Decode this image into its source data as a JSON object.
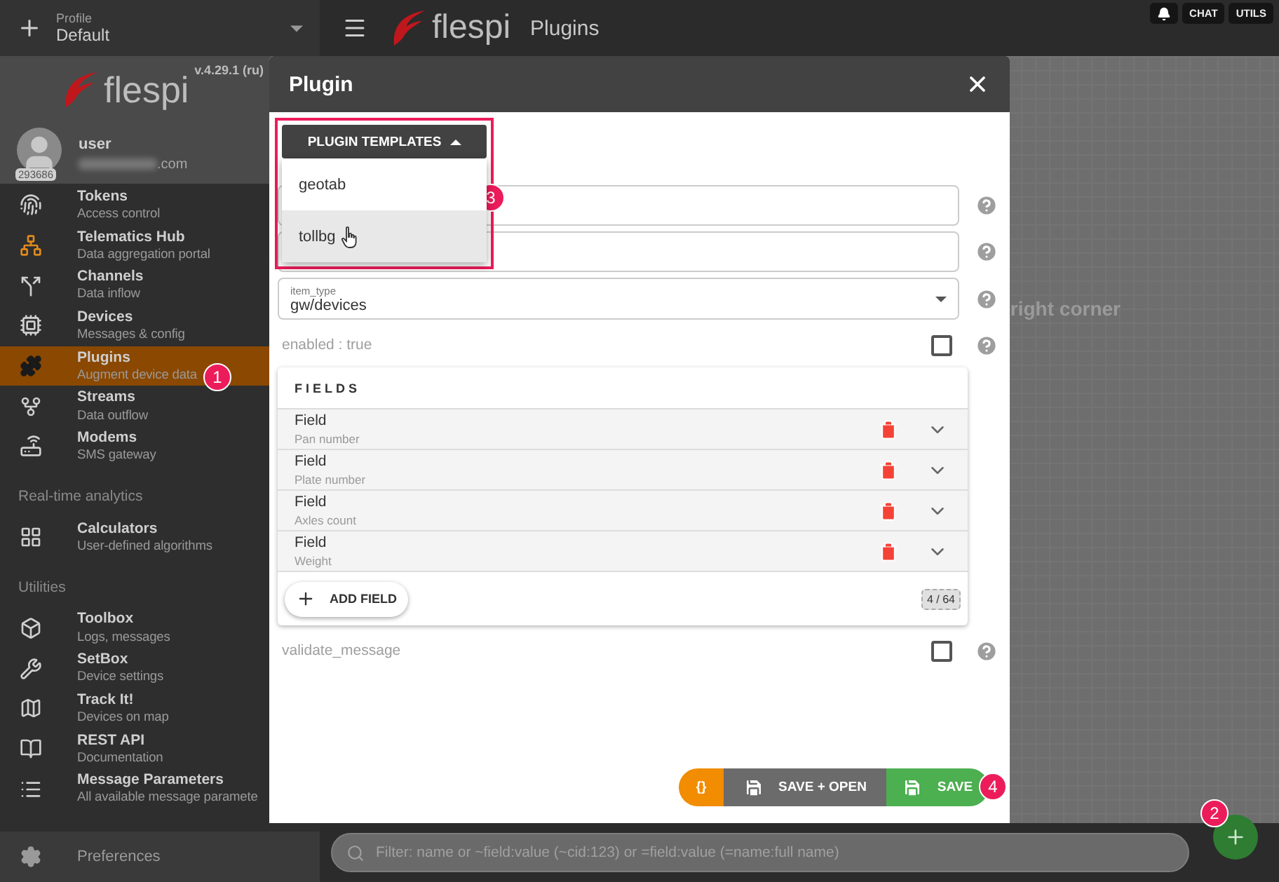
{
  "profile": {
    "label": "Profile",
    "value": "Default"
  },
  "sidebar_logo": "flespi",
  "version": "v.4.29.1 (ru)",
  "user": {
    "id": "293686",
    "name": "user",
    "email_suffix": ".com"
  },
  "sidebar": {
    "sections": [
      {
        "items": [
          {
            "title": "Tokens",
            "subtitle": "Access control",
            "selected": false
          },
          {
            "title": "Telematics Hub",
            "subtitle": "Data aggregation portal",
            "selected": false
          },
          {
            "title": "Channels",
            "subtitle": "Data inflow",
            "selected": false
          },
          {
            "title": "Devices",
            "subtitle": "Messages & config",
            "selected": false
          },
          {
            "title": "Plugins",
            "subtitle": "Augment device data",
            "selected": true
          },
          {
            "title": "Streams",
            "subtitle": "Data outflow",
            "selected": false
          },
          {
            "title": "Modems",
            "subtitle": "SMS gateway",
            "selected": false
          }
        ]
      },
      {
        "title": "Real-time analytics",
        "items": [
          {
            "title": "Calculators",
            "subtitle": "User-defined algorithms",
            "selected": false
          }
        ]
      },
      {
        "title": "Utilities",
        "items": [
          {
            "title": "Toolbox",
            "subtitle": "Logs, messages",
            "selected": false
          },
          {
            "title": "SetBox",
            "subtitle": "Device settings",
            "selected": false
          },
          {
            "title": "Track It!",
            "subtitle": "Devices on map",
            "selected": false
          },
          {
            "title": "REST API",
            "subtitle": "Documentation",
            "selected": false
          },
          {
            "title": "Message Parameters",
            "subtitle": "All available message paramete",
            "selected": false
          }
        ]
      }
    ],
    "footer": "Preferences"
  },
  "header": {
    "logo": "flespi",
    "title": "Plugins",
    "buttons": [
      "CHAT",
      "UTILS"
    ]
  },
  "background_text": "right corner",
  "modal": {
    "title": "Plugin",
    "templates": {
      "label": "PLUGIN TEMPLATES",
      "expanded": true,
      "options": [
        {
          "label": "geotab",
          "hovered": false
        },
        {
          "label": "tollbg",
          "hovered": true
        }
      ]
    },
    "inputs": [
      {
        "kind": "text"
      },
      {
        "kind": "text"
      },
      {
        "kind": "select",
        "label": "item_type",
        "value": "gw/devices"
      }
    ],
    "enabled": {
      "label": "enabled : true",
      "checked": false
    },
    "fields": {
      "title": "FIELDS",
      "items": [
        {
          "name": "Field",
          "description": "Pan number"
        },
        {
          "name": "Field",
          "description": "Plate number"
        },
        {
          "name": "Field",
          "description": "Axles count"
        },
        {
          "name": "Field",
          "description": "Weight"
        }
      ],
      "add_label": "ADD FIELD",
      "count": "4 / 64"
    },
    "validate": {
      "label": "validate_message",
      "checked": false
    },
    "actions": [
      {
        "kind": "json",
        "label": "{}"
      },
      {
        "kind": "save_open",
        "label": "SAVE + OPEN"
      },
      {
        "kind": "save",
        "label": "SAVE"
      }
    ]
  },
  "filter": {
    "placeholder": "Filter: name or ~field:value (~cid:123) or =field:value (=name:full name)"
  },
  "annotations": [
    "1",
    "2",
    "3",
    "4"
  ]
}
